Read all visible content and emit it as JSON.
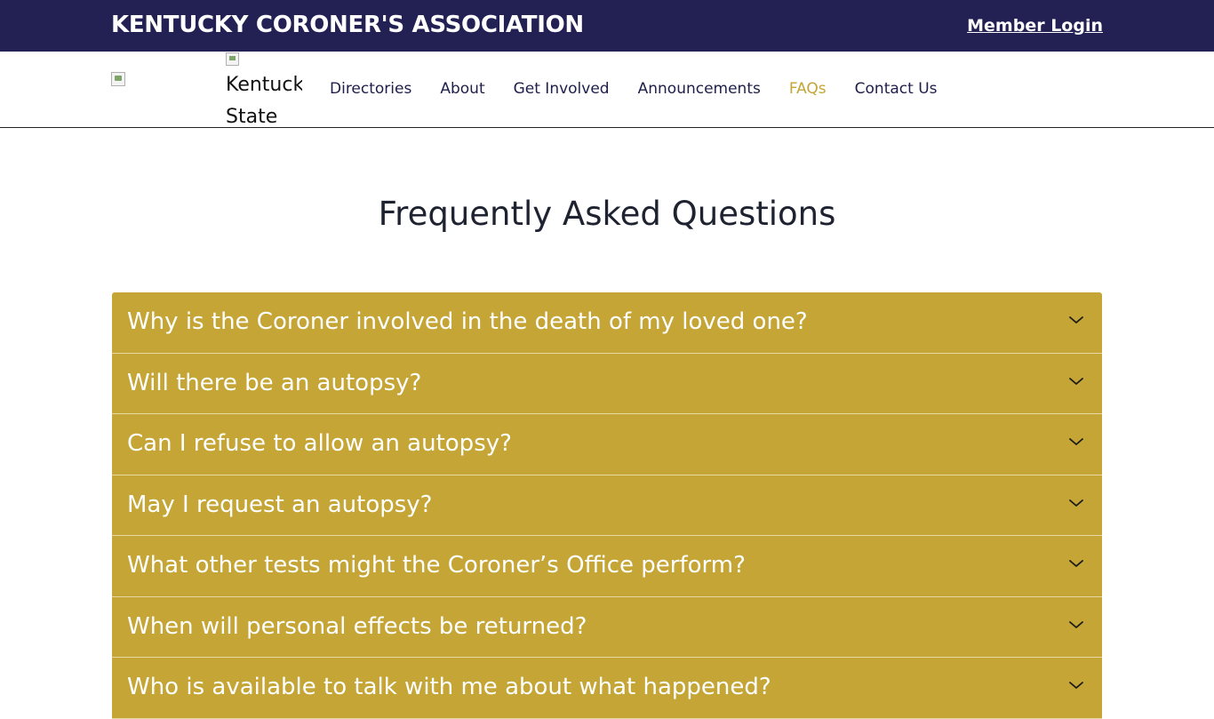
{
  "header": {
    "site_title": "KENTUCKY CORONER'S ASSOCIATION",
    "member_login": "Member Login"
  },
  "logo": {
    "state_alt_line1": "Kentuck",
    "state_alt_line2": "State"
  },
  "nav": {
    "items": [
      {
        "label": "Directories"
      },
      {
        "label": "About"
      },
      {
        "label": "Get Involved"
      },
      {
        "label": "Announcements"
      },
      {
        "label": "FAQs",
        "active": true
      },
      {
        "label": "Contact Us"
      }
    ]
  },
  "main": {
    "heading": "Frequently Asked Questions",
    "faqs": [
      {
        "question": "Why is the Coroner involved in the death of my loved one?"
      },
      {
        "question": "Will there be an autopsy?"
      },
      {
        "question": "Can I refuse to allow an autopsy?"
      },
      {
        "question": "May I request an autopsy?"
      },
      {
        "question": "What other tests might the Coroner’s Office perform?"
      },
      {
        "question": "When will personal effects be returned?"
      },
      {
        "question": "Who is available to talk with me about what happened?"
      }
    ]
  },
  "colors": {
    "topbar": "#232154",
    "accent_gold": "#c4a535",
    "nav_text": "#1d1f4a"
  },
  "icons": {
    "faq_toggle": "chevron-down-icon",
    "broken_image": "broken-image-icon"
  }
}
